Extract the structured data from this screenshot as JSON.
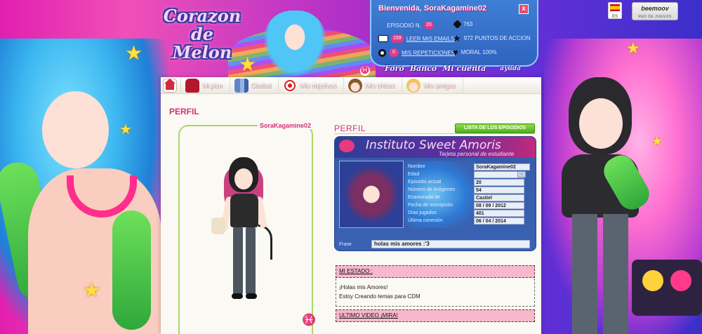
{
  "logo": {
    "lines": [
      "Corazon",
      "de",
      "Melon"
    ]
  },
  "user_panel": {
    "welcome": "Bienvenida, SoraKagamine02",
    "close": "x",
    "episode_label": "EPISODIO N.",
    "episode_number": "20",
    "diamonds": "763",
    "mail_badge": "159",
    "mail_link": "LEER MIS EMAILS",
    "action_points": "972 PUNTOS DE ACCION",
    "replays_badge": "0",
    "replays_link": "MIS REPETICIONES",
    "morale": "MORAL 100%"
  },
  "panel_links": [
    "Foro",
    "Banco",
    "Mi cuenta"
  ],
  "help_link": "ayuda",
  "zodiac_symbol": "♓",
  "lang": {
    "code": "ES"
  },
  "partner": {
    "name": "beemoov",
    "subtitle": "RED DE JUEGOS"
  },
  "nav": [
    {
      "label": "",
      "icon": "home-icon"
    },
    {
      "label": "Mi piso",
      "icon": "sofa-icon"
    },
    {
      "label": "Ciudad",
      "icon": "city-icon"
    },
    {
      "label": "Mis objetivos",
      "icon": "target-icon"
    },
    {
      "label": "Mis chicos",
      "icon": "boy-icon"
    },
    {
      "label": "Mis amigas",
      "icon": "girl-icon"
    }
  ],
  "profile": {
    "title": "PERFIL",
    "username": "SoraKagamine02",
    "section_title": "PERFIL",
    "episodes_button": "LISTA DE LOS EPISODIOS"
  },
  "id_card": {
    "school": "Instituto Sweet Amoris",
    "subtitle": "Tarjeta personal de estudiante",
    "fields": [
      {
        "key": "Nombre",
        "value": "SoraKagamine02"
      },
      {
        "key": "Edad",
        "value": ""
      },
      {
        "key": "Episodio actual",
        "value": "20"
      },
      {
        "key": "Número de imágenes",
        "value": "54"
      },
      {
        "key": "Enamorada de",
        "value": "Castiel"
      },
      {
        "key": "Fecha de inscripción",
        "value": "08 / 09 / 2012"
      },
      {
        "key": "Días jugados",
        "value": "401"
      },
      {
        "key": "Última conexión",
        "value": "06 / 04 / 2014"
      }
    ],
    "phrase_label": "Frase",
    "phrase": "holas mis amores :'3"
  },
  "status": {
    "heading": "MI ESTADO :",
    "lines": [
      "¡Holas mis Amores!",
      "Estoy Creando temas para CDM"
    ]
  },
  "video": {
    "heading": "ULTIMO VIDEO ¡MIRA!"
  }
}
